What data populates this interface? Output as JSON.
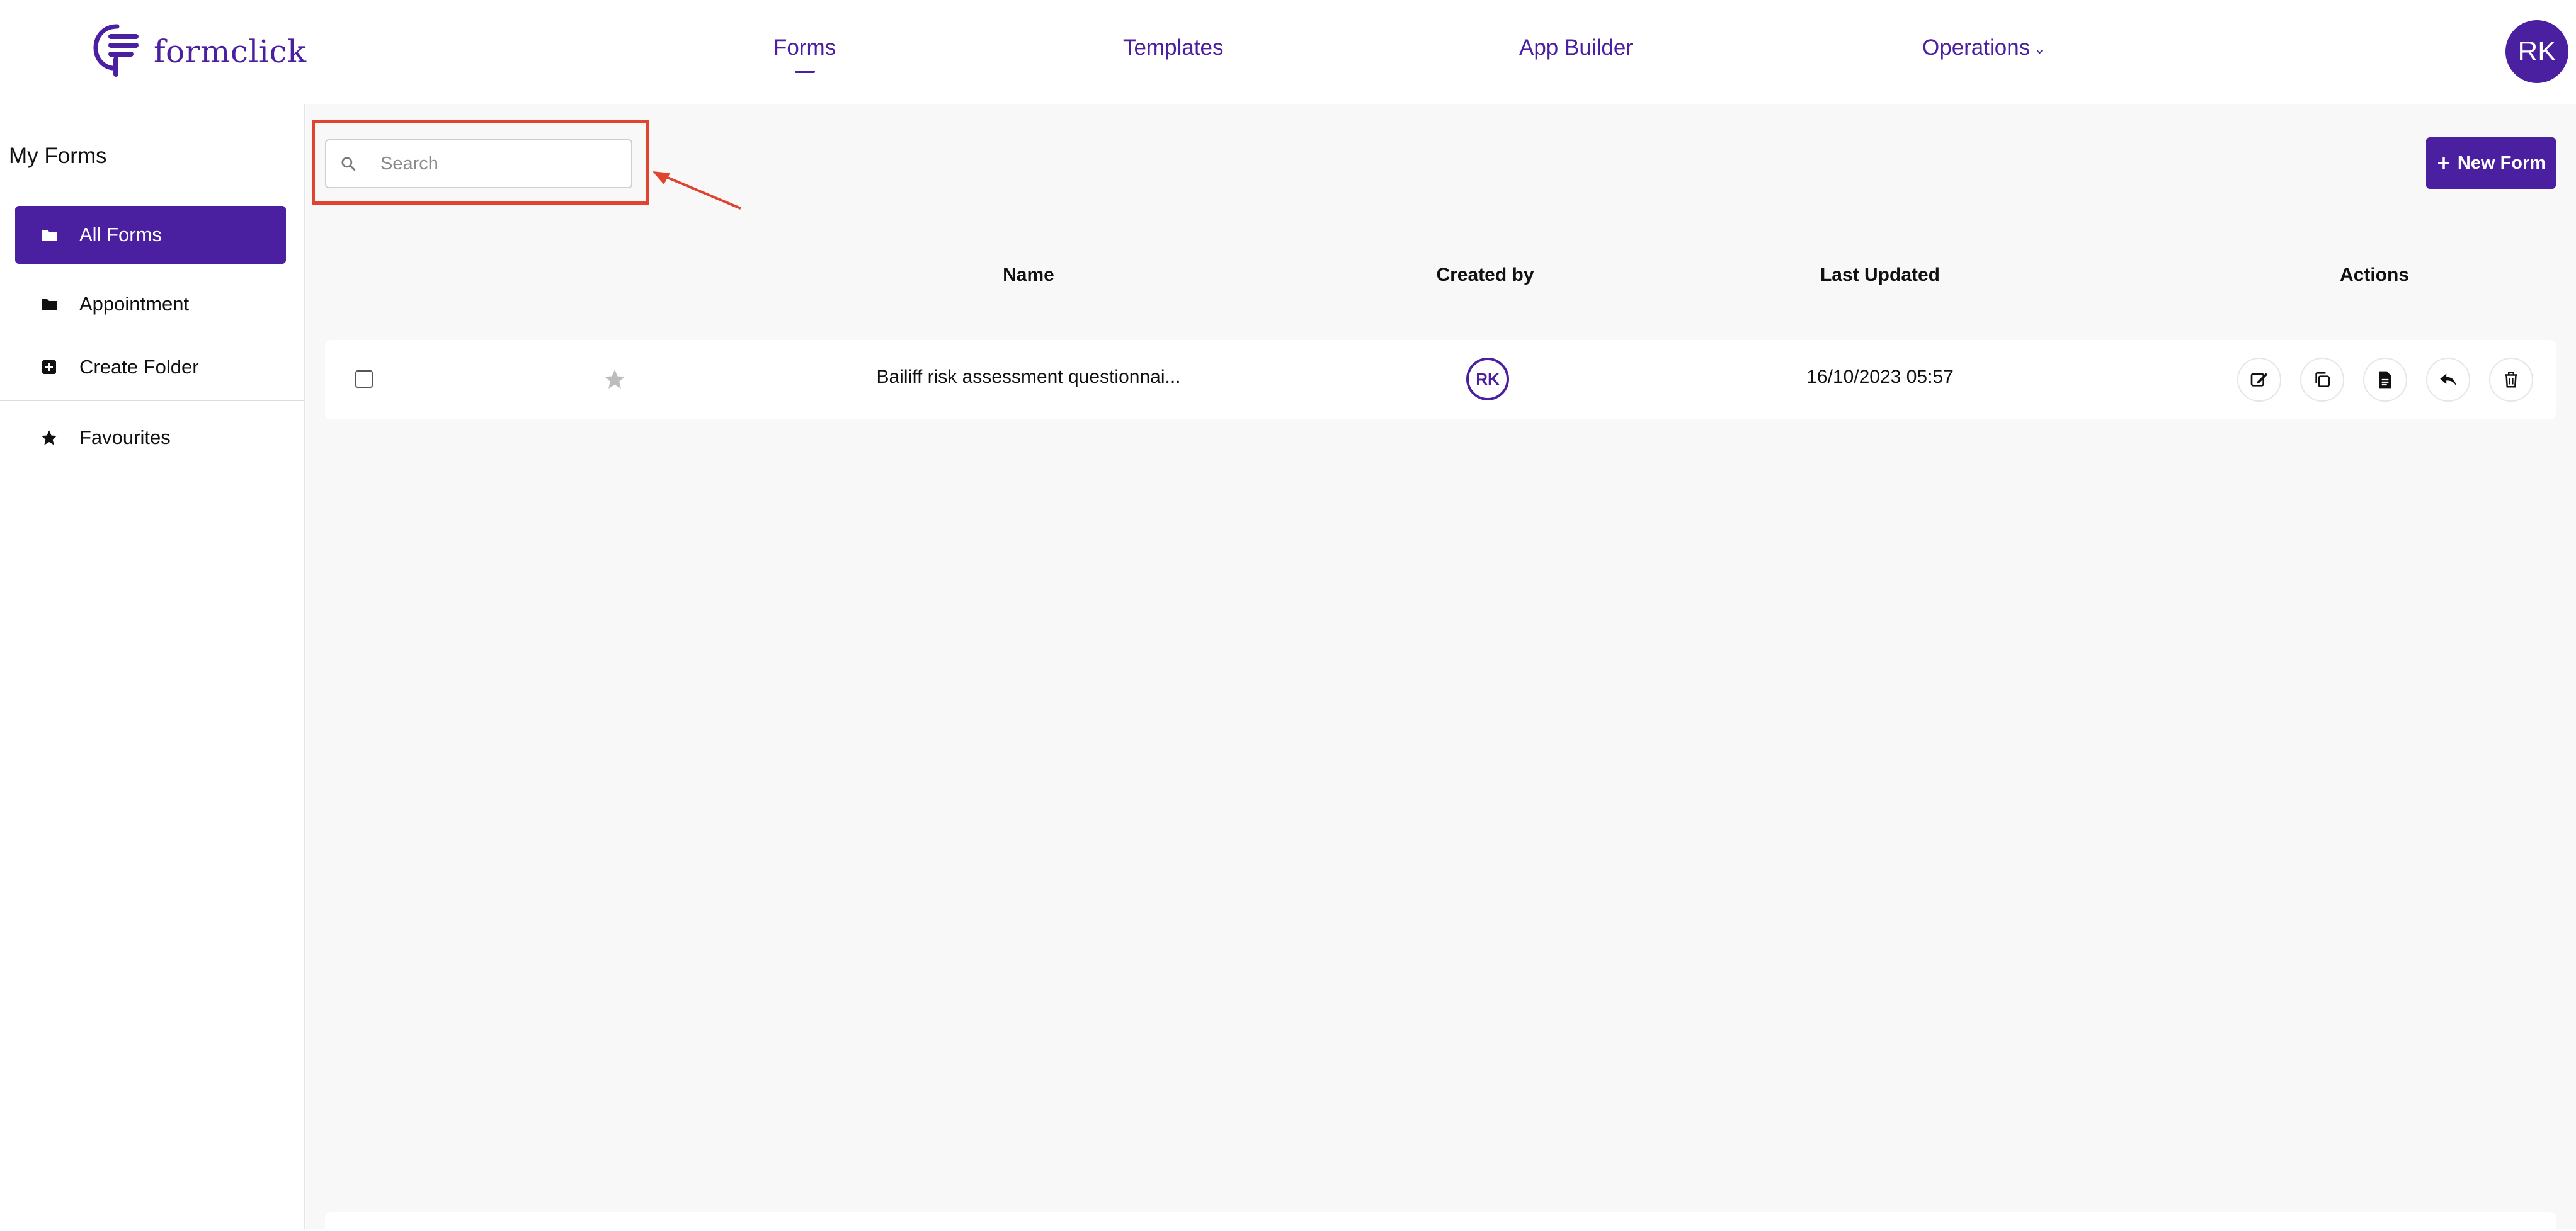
{
  "brand": {
    "name": "formclick"
  },
  "nav": {
    "items": [
      "Forms",
      "Templates",
      "App Builder",
      "Operations"
    ],
    "active": "Forms"
  },
  "user": {
    "initials": "RK"
  },
  "sidebar": {
    "title": "My Forms",
    "items": [
      {
        "label": "All Forms",
        "icon": "folder-icon",
        "active": true
      },
      {
        "label": "Appointment",
        "icon": "folder-icon",
        "active": false
      },
      {
        "label": "Create Folder",
        "icon": "plus-square-icon",
        "active": false
      },
      {
        "label": "Favourites",
        "icon": "star-icon",
        "active": false
      }
    ]
  },
  "search": {
    "placeholder": "Search",
    "value": ""
  },
  "toolbar": {
    "new_form_label": "New Form"
  },
  "table": {
    "headers": [
      "Name",
      "Created by",
      "Last Updated",
      "Actions"
    ],
    "rows": [
      {
        "name": "Bailiff risk assessment questionnai...",
        "created_by": "RK",
        "last_updated": "16/10/2023 05:57",
        "actions": [
          "edit-icon",
          "copy-icon",
          "document-icon",
          "share-back-icon",
          "trash-icon"
        ]
      }
    ]
  },
  "colors": {
    "brand": "#4a1fa0",
    "highlight": "#e0432f",
    "background": "#f8f8f8"
  }
}
